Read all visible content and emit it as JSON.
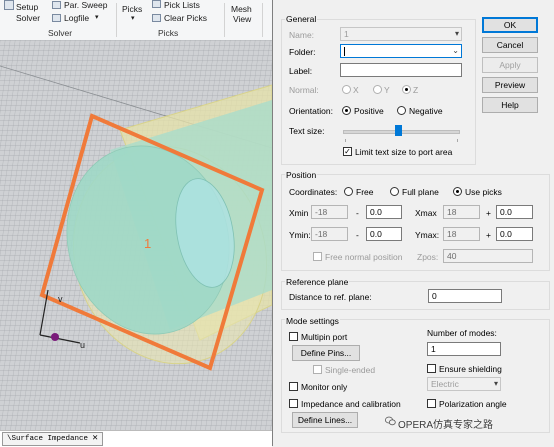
{
  "ribbon": {
    "setup_label": "Setup",
    "solver_label": "Solver",
    "par_sweep_label": "Par. Sweep",
    "logfile_label": "Logfile",
    "solver_group": "Solver",
    "picks_label": "Picks",
    "pick_lists_label": "Pick Lists",
    "clear_picks_label": "Clear Picks",
    "picks_group": "Picks",
    "mesh_label": "Mesh",
    "view_label": "View"
  },
  "viewport": {
    "port_number": "1",
    "axis_v_label": "v",
    "axis_u_label": "u",
    "colors": {
      "background": "#cfd1d4",
      "port_outline": "#f07a3a",
      "cylinder_fill": "#b7e3cf",
      "cylinder_edge": "#d9d98a",
      "grid": "#9fa4a8"
    }
  },
  "status_tab": {
    "label": "\\Surface Impedance",
    "close_icon": "close-icon"
  },
  "dialog": {
    "general": {
      "title": "General",
      "name_label": "Name:",
      "name_value": "1",
      "folder_label": "Folder:",
      "folder_value": "",
      "label_label": "Label:",
      "label_value": "",
      "normal_label": "Normal:",
      "normal_options": [
        "X",
        "Y",
        "Z"
      ],
      "orientation_label": "Orientation:",
      "positive_label": "Positive",
      "negative_label": "Negative",
      "text_size_label": "Text size:",
      "text_size_fraction": 0.48,
      "limit_text_label": "Limit text size to port area",
      "limit_text_checked": true
    },
    "buttons": {
      "ok": "OK",
      "cancel": "Cancel",
      "apply": "Apply",
      "preview": "Preview",
      "help": "Help"
    },
    "position": {
      "title": "Position",
      "coordinates_label": "Coordinates:",
      "free_label": "Free",
      "full_plane_label": "Full plane",
      "use_picks_label": "Use picks",
      "xmin_label": "Xmin",
      "xmin_value": "-18",
      "xmin_offset": "0.0",
      "xmax_label": "Xmax",
      "xmax_value": "18",
      "xmax_offset": "0.0",
      "ymin_label": "Ymin:",
      "ymin_value": "-18",
      "ymin_offset": "0.0",
      "ymax_label": "Ymax:",
      "ymax_value": "18",
      "ymax_offset": "0.0",
      "minus": "-",
      "plus": "+",
      "free_normal_label": "Free normal position",
      "zpos_label": "Zpos:",
      "zpos_value": "40"
    },
    "reference_plane": {
      "title": "Reference plane",
      "distance_label": "Distance to ref. plane:",
      "distance_value": "0"
    },
    "mode_settings": {
      "title": "Mode settings",
      "multipin_label": "Multipin port",
      "define_pins_label": "Define Pins...",
      "single_ended_label": "Single-ended",
      "monitor_only_label": "Monitor only",
      "impedance_label": "Impedance and calibration",
      "define_lines_label": "Define Lines...",
      "number_of_modes_label": "Number of modes:",
      "number_of_modes_value": "1",
      "ensure_shielding_label": "Ensure shielding",
      "electric_value": "Electric",
      "polarization_label": "Polarization angle"
    }
  },
  "watermark": {
    "text": "OPERA仿真专家之路"
  }
}
